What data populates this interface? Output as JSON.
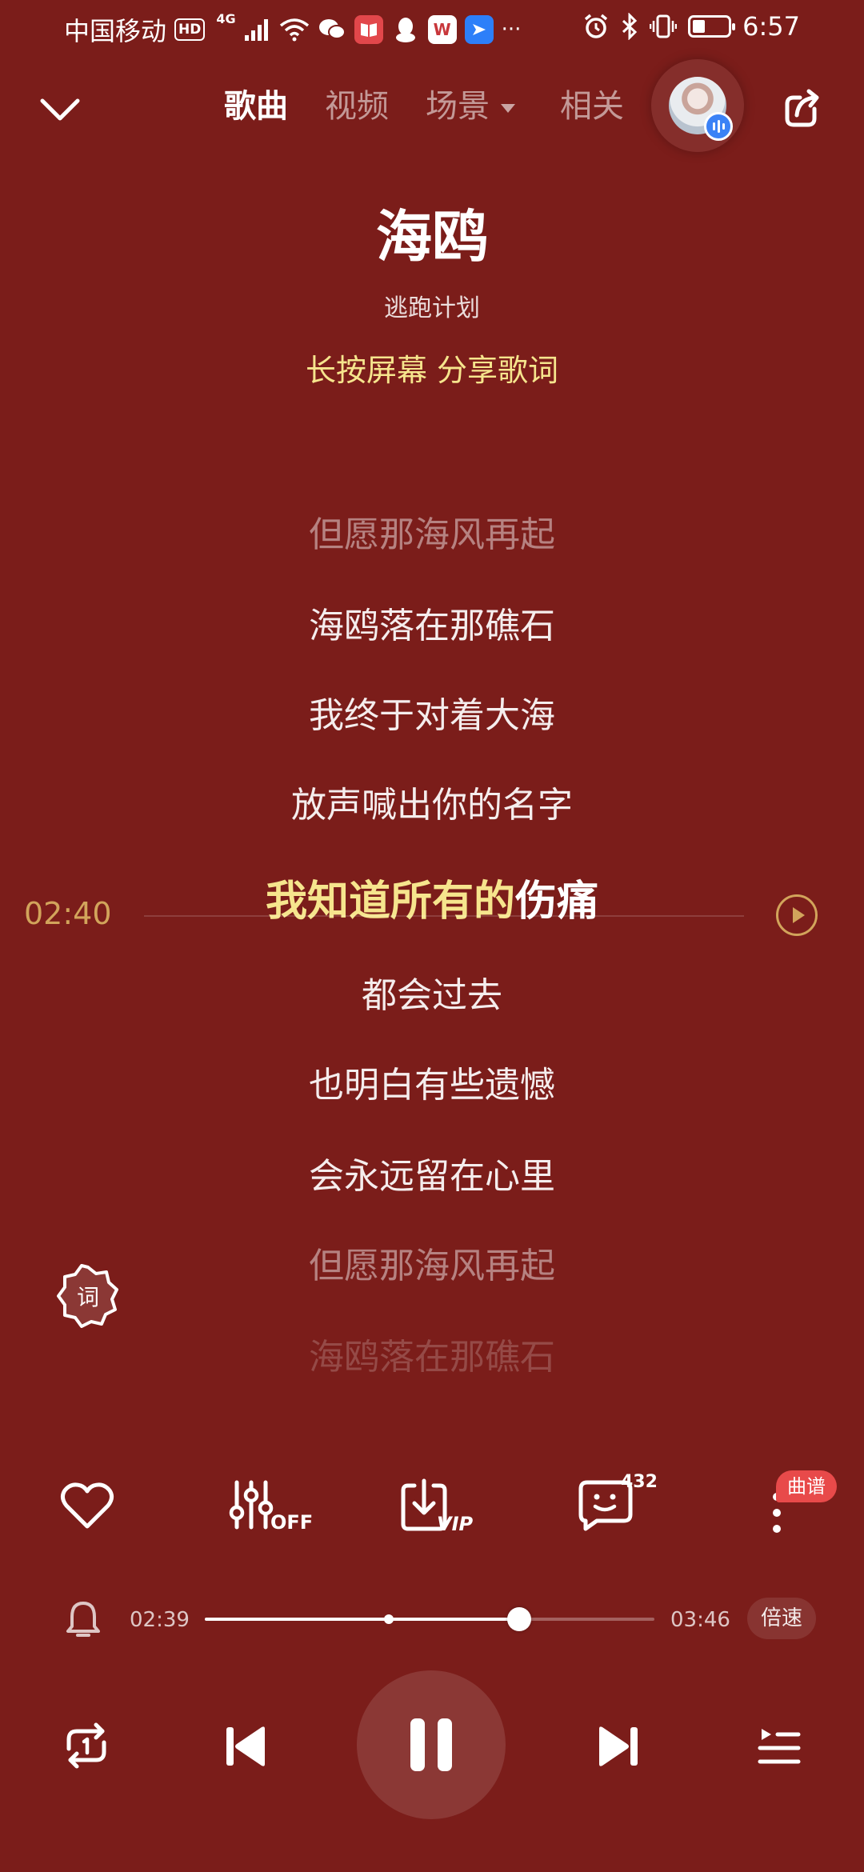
{
  "status_bar": {
    "carrier": "中国移动",
    "hd": "HD",
    "network": "4G",
    "more": "···",
    "time": "6:57",
    "battery_level": 0.35,
    "app_icons": [
      {
        "name": "wechat-icon",
        "color": "#ffffff"
      },
      {
        "name": "reader-icon",
        "color": "#e2474b"
      },
      {
        "name": "qq-icon",
        "color": "#ffffff"
      },
      {
        "name": "wps-icon",
        "color": "#c8373b",
        "glyph": "W"
      },
      {
        "name": "feishu-icon",
        "color": "#2d7ff9"
      }
    ]
  },
  "header": {
    "tabs": [
      {
        "label": "歌曲",
        "active": true
      },
      {
        "label": "视频",
        "active": false
      },
      {
        "label": "场景",
        "active": false,
        "has_dropdown": true
      },
      {
        "label": "相关",
        "active": false
      }
    ]
  },
  "song": {
    "title": "海鸥",
    "artist": "逃跑计划",
    "share_hint": "长按屏幕 分享歌词"
  },
  "lyrics": {
    "current_time": "02:40",
    "lines_before": [
      {
        "text": "但愿那海风再起",
        "style": "dim"
      },
      {
        "text": "海鸥落在那礁石",
        "style": "normal"
      },
      {
        "text": "我终于对着大海",
        "style": "normal"
      },
      {
        "text": "放声喊出你的名字",
        "style": "normal"
      }
    ],
    "current_line": {
      "sung": "我知道所有的",
      "unsung": "伤痛"
    },
    "lines_after": [
      {
        "text": "都会过去",
        "style": "normal"
      },
      {
        "text": "也明白有些遗憾",
        "style": "normal"
      },
      {
        "text": "会永远留在心里",
        "style": "normal"
      },
      {
        "text": "但愿那海风再起",
        "style": "dim"
      },
      {
        "text": "海鸥落在那礁石",
        "style": "fade"
      }
    ],
    "mode_label": "词"
  },
  "actions": {
    "like_icon": "heart-icon",
    "sound_effect_label": "OFF",
    "download_label": "VIP",
    "comment_count": "432",
    "score_badge": "曲谱"
  },
  "player": {
    "elapsed": "02:39",
    "duration": "03:46",
    "progress": 0.7,
    "buffered": 0.41,
    "speed_label": "倍速"
  },
  "colors": {
    "background": "#7b1d1a",
    "highlight": "#f6e58d",
    "accent_gold": "#d2a45b",
    "badge_red": "#e84a4a"
  }
}
